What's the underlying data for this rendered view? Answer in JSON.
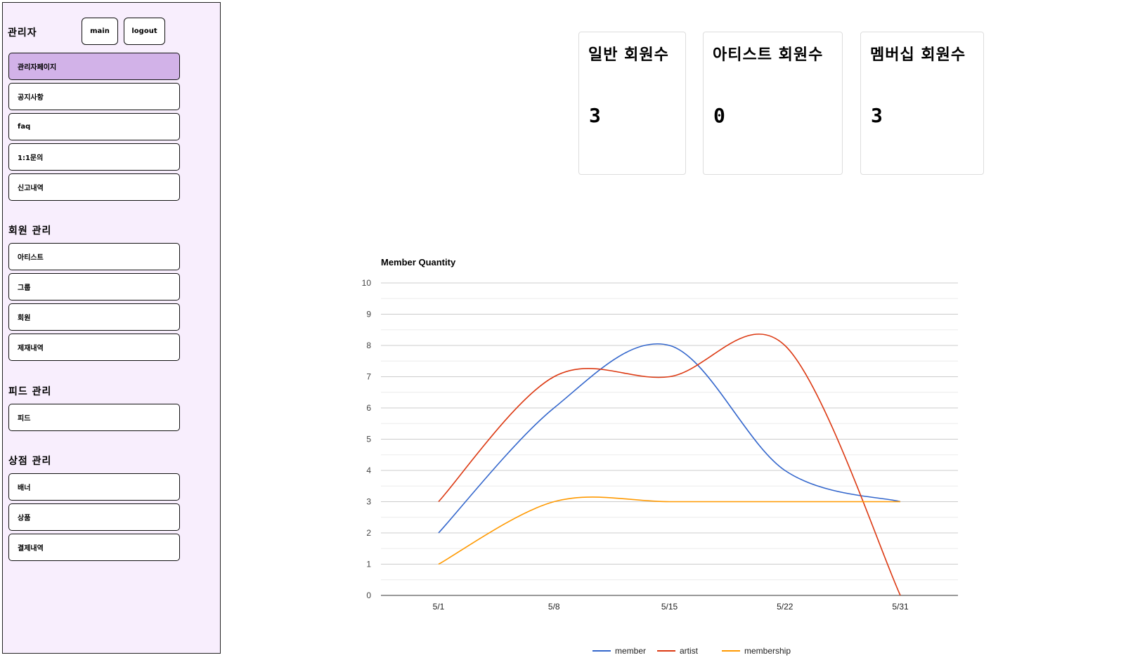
{
  "sidebar": {
    "header": "관리자",
    "main_button": "main",
    "logout_button": "logout",
    "items": [
      "관리자페이지",
      "공지사항",
      "faq",
      "1:1문의",
      "신고내역"
    ],
    "sections": [
      {
        "title": "회원 관리",
        "items": [
          "아티스트",
          "그룹",
          "회원",
          "제재내역"
        ]
      },
      {
        "title": "피드 관리",
        "items": [
          "피드"
        ]
      },
      {
        "title": "상점 관리",
        "items": [
          "배너",
          "상품",
          "결제내역"
        ]
      }
    ]
  },
  "cards": [
    {
      "title": "일반 회원수",
      "value": "3"
    },
    {
      "title": "아티스트 회원수",
      "value": "0"
    },
    {
      "title": "멤버십 회원수",
      "value": "3"
    }
  ],
  "chart_data": {
    "type": "line",
    "title": "Member Quantity",
    "categories": [
      "5/1",
      "5/8",
      "5/15",
      "5/22",
      "5/31"
    ],
    "series": [
      {
        "name": "member",
        "color": "#3366cc",
        "values": [
          2,
          6,
          8,
          4,
          3
        ]
      },
      {
        "name": "artist",
        "color": "#dc3912",
        "values": [
          3,
          7,
          7,
          8,
          0
        ]
      },
      {
        "name": "membership",
        "color": "#ff9900",
        "values": [
          1,
          3,
          3,
          3,
          3
        ]
      }
    ],
    "ylim": [
      0,
      10
    ],
    "yticks": [
      "0",
      "1",
      "2",
      "3",
      "4",
      "5",
      "6",
      "7",
      "8",
      "9",
      "10"
    ],
    "smooth": true,
    "grid": true,
    "legend": "bottom"
  }
}
